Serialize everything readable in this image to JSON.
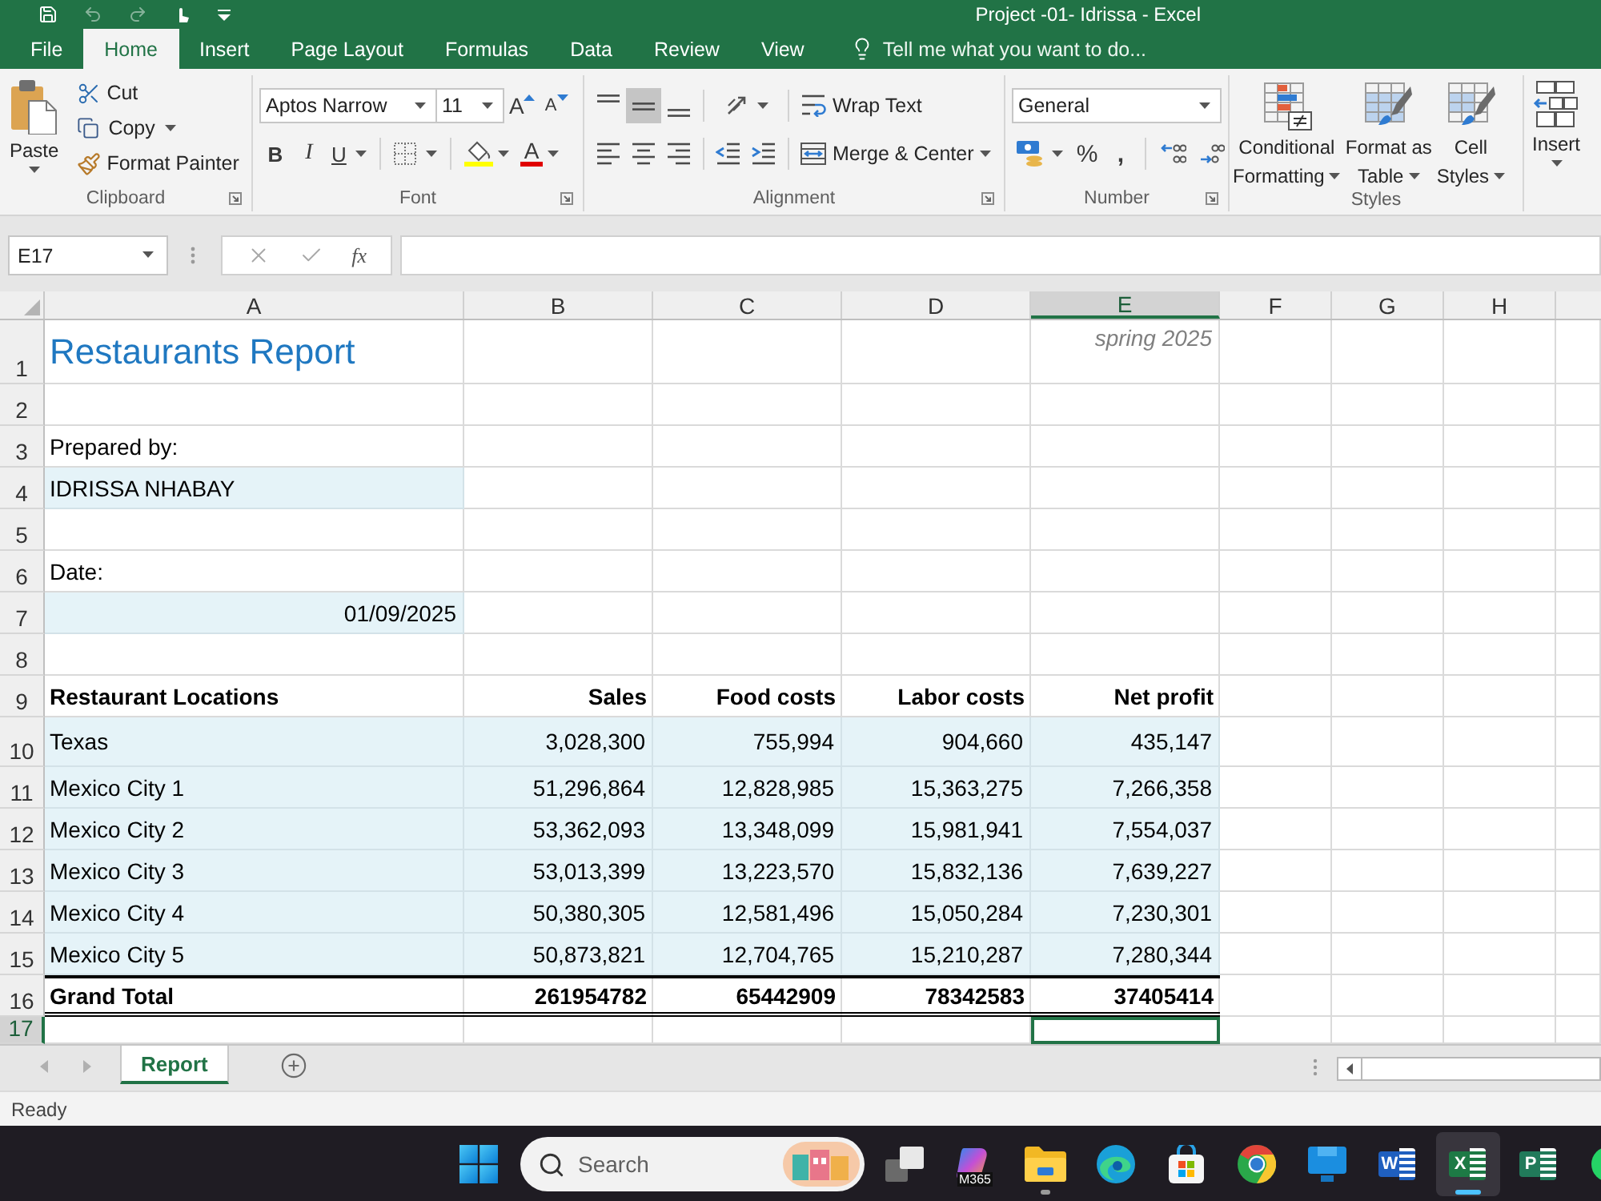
{
  "window": {
    "title": "Project -01- Idrissa - Excel"
  },
  "quick_access": [
    {
      "kind": "save",
      "disabled": false
    },
    {
      "kind": "undo",
      "disabled": true
    },
    {
      "kind": "redo",
      "disabled": true
    },
    {
      "kind": "touch",
      "disabled": false
    },
    {
      "kind": "customize",
      "disabled": false
    }
  ],
  "ribbon_tabs": [
    {
      "label": "File",
      "selected": false
    },
    {
      "label": "Home",
      "selected": true
    },
    {
      "label": "Insert",
      "selected": false
    },
    {
      "label": "Page Layout",
      "selected": false
    },
    {
      "label": "Formulas",
      "selected": false
    },
    {
      "label": "Data",
      "selected": false
    },
    {
      "label": "Review",
      "selected": false
    },
    {
      "label": "View",
      "selected": false
    }
  ],
  "tell_me": {
    "placeholder": "Tell me what you want to do..."
  },
  "clipboard": {
    "paste": "Paste",
    "cut": "Cut",
    "copy": "Copy",
    "format_painter": "Format Painter",
    "label": "Clipboard"
  },
  "font": {
    "name": "Aptos Narrow",
    "size": "11",
    "grow": "A",
    "shrink": "A",
    "bold": "B",
    "italic": "I",
    "underline": "U",
    "fg_letter": "A",
    "label": "Font"
  },
  "alignment": {
    "vertical": [
      {
        "kind": "top",
        "selected": false
      },
      {
        "kind": "middle",
        "selected": true
      },
      {
        "kind": "bottom",
        "selected": false
      }
    ],
    "horizontal": [
      {
        "kind": "left"
      },
      {
        "kind": "center"
      },
      {
        "kind": "right"
      }
    ],
    "wrap_text": "Wrap Text",
    "merge": "Merge & Center",
    "label": "Alignment"
  },
  "number": {
    "format": "General",
    "percent": "%",
    "comma": ",",
    "label": "Number"
  },
  "styles": {
    "buttons": [
      {
        "kind": "conditional",
        "lines": [
          "Conditional",
          "Formatting"
        ]
      },
      {
        "kind": "table",
        "lines": [
          "Format as",
          "Table"
        ]
      },
      {
        "kind": "cell",
        "lines": [
          "Cell",
          "Styles"
        ]
      }
    ],
    "label": "Styles"
  },
  "cells": {
    "insert": "Insert"
  },
  "formula_bar": {
    "name_box": "E17",
    "function": "fx"
  },
  "columns": [
    {
      "label": "A",
      "selected": false
    },
    {
      "label": "B",
      "selected": false
    },
    {
      "label": "C",
      "selected": false
    },
    {
      "label": "D",
      "selected": false
    },
    {
      "label": "E",
      "selected": true
    },
    {
      "label": "F",
      "selected": false
    },
    {
      "label": "G",
      "selected": false
    },
    {
      "label": "H",
      "selected": false
    }
  ],
  "rows": [
    {
      "number": "1",
      "kind": "title",
      "selected": false,
      "title": "Restaurants Report",
      "note": "spring 2025"
    },
    {
      "number": "2",
      "kind": "blank",
      "selected": false
    },
    {
      "number": "3",
      "kind": "label",
      "selected": false,
      "text": "Prepared by:"
    },
    {
      "number": "4",
      "kind": "field",
      "selected": false,
      "text": "IDRISSA NHABAY"
    },
    {
      "number": "5",
      "kind": "blank",
      "selected": false
    },
    {
      "number": "6",
      "kind": "label",
      "selected": false,
      "text": "Date:"
    },
    {
      "number": "7",
      "kind": "date",
      "selected": false,
      "date": "01/09/2025"
    },
    {
      "number": "8",
      "kind": "blank",
      "selected": false
    },
    {
      "number": "9",
      "kind": "header",
      "selected": false,
      "cells": [
        "Restaurant Locations",
        "Sales",
        "Food costs",
        "Labor costs",
        "Net profit"
      ]
    },
    {
      "number": "10",
      "kind": "data",
      "selected": false,
      "cells": [
        "Texas",
        "3,028,300",
        "755,994",
        "904,660",
        "435,147"
      ]
    },
    {
      "number": "11",
      "kind": "data",
      "selected": false,
      "cells": [
        "Mexico City 1",
        "51,296,864",
        "12,828,985",
        "15,363,275",
        "7,266,358"
      ]
    },
    {
      "number": "12",
      "kind": "data",
      "selected": false,
      "cells": [
        "Mexico City 2",
        "53,362,093",
        "13,348,099",
        "15,981,941",
        "7,554,037"
      ]
    },
    {
      "number": "13",
      "kind": "data",
      "selected": false,
      "cells": [
        "Mexico City 3",
        "53,013,399",
        "13,223,570",
        "15,832,136",
        "7,639,227"
      ]
    },
    {
      "number": "14",
      "kind": "data",
      "selected": false,
      "cells": [
        "Mexico City 4",
        "50,380,305",
        "12,581,496",
        "15,050,284",
        "7,230,301"
      ]
    },
    {
      "number": "15",
      "kind": "data",
      "selected": false,
      "cells": [
        "Mexico City 5",
        "50,873,821",
        "12,704,765",
        "15,210,287",
        "7,280,344"
      ]
    },
    {
      "number": "16",
      "kind": "total",
      "selected": false,
      "cells": [
        "Grand Total",
        "261954782",
        "65442909",
        "78342583",
        "37405414"
      ]
    },
    {
      "number": "17",
      "kind": "blank",
      "selected": true
    }
  ],
  "sheet_tabs": [
    {
      "label": "Report",
      "selected": true
    }
  ],
  "status_bar": {
    "text": "Ready"
  },
  "taskbar": {
    "search": {
      "placeholder": "Search"
    },
    "apps": [
      {
        "kind": "task_view",
        "running": false,
        "selected": false
      },
      {
        "kind": "m365",
        "badge": "M365",
        "running": false,
        "selected": false
      },
      {
        "kind": "explorer",
        "running": true,
        "selected": false
      },
      {
        "kind": "edge",
        "running": false,
        "selected": false
      },
      {
        "kind": "store",
        "running": false,
        "selected": false
      },
      {
        "kind": "chrome",
        "running": false,
        "selected": false
      },
      {
        "kind": "monitor",
        "running": false,
        "selected": false
      },
      {
        "kind": "word",
        "letter": "W",
        "running": false,
        "selected": false
      },
      {
        "kind": "excel",
        "letter": "X",
        "running": true,
        "selected": true
      },
      {
        "kind": "project",
        "letter": "P",
        "running": false,
        "selected": false
      },
      {
        "kind": "chat",
        "running": false,
        "selected": false
      }
    ]
  }
}
